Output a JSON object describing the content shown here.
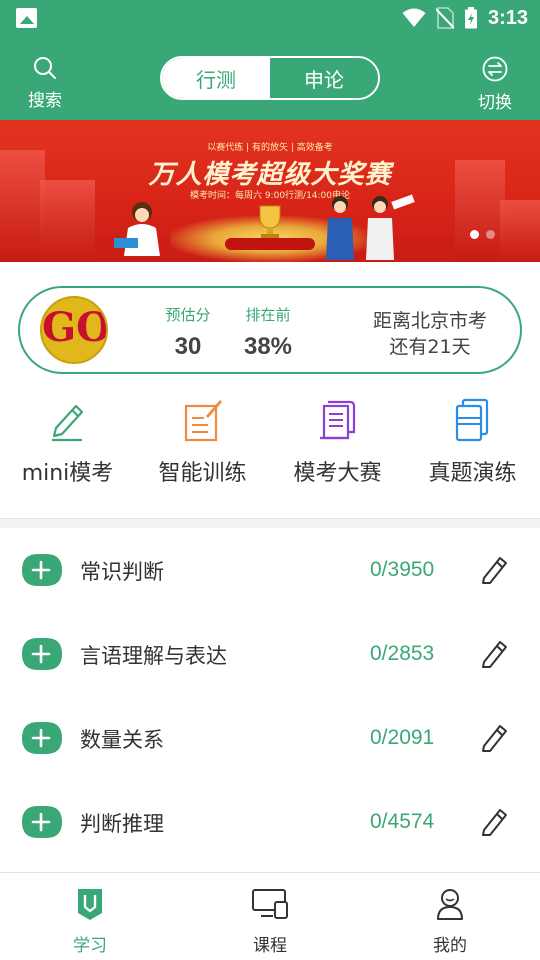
{
  "status_bar": {
    "time": "3:13",
    "icons": [
      "image-icon",
      "wifi-icon",
      "no-sim-icon",
      "battery-icon"
    ]
  },
  "header": {
    "search_label": "搜索",
    "switch_label": "切换",
    "tabs": [
      {
        "label": "行测",
        "active": true
      },
      {
        "label": "申论",
        "active": false
      }
    ]
  },
  "banner": {
    "topline": "以赛代练 | 有的放矢 | 高效备考",
    "title": "万人模考超级大奖赛",
    "subtitle": "模考时间：每周六 9:00行测/14:00申论",
    "active_dot": 0,
    "dot_count": 2
  },
  "score_card": {
    "avatar_text": "GO",
    "estimated_label": "预估分",
    "estimated_value": "30",
    "rank_label": "排在前",
    "rank_value": "38%",
    "exam_line1": "距离北京市考",
    "exam_line2": "还有21天"
  },
  "quick_entries": [
    {
      "label": "mini模考",
      "icon": "pencil-icon",
      "color": "#3aa876"
    },
    {
      "label": "智能训练",
      "icon": "notepad-pen-icon",
      "color": "#f08a3c"
    },
    {
      "label": "模考大赛",
      "icon": "scroll-icon",
      "color": "#8a3fd8"
    },
    {
      "label": "真题演练",
      "icon": "books-icon",
      "color": "#2a8ee6"
    }
  ],
  "categories": [
    {
      "name": "常识判断",
      "progress": "0/3950"
    },
    {
      "name": "言语理解与表达",
      "progress": "0/2853"
    },
    {
      "name": "数量关系",
      "progress": "0/2091"
    },
    {
      "name": "判断推理",
      "progress": "0/4574"
    }
  ],
  "bottom_nav": [
    {
      "label": "学习",
      "icon": "study-icon",
      "active": true
    },
    {
      "label": "课程",
      "icon": "course-icon",
      "active": false
    },
    {
      "label": "我的",
      "icon": "profile-icon",
      "active": false
    }
  ],
  "colors": {
    "primary": "#3aa876",
    "text": "#333333",
    "banner_red": "#d82418"
  }
}
